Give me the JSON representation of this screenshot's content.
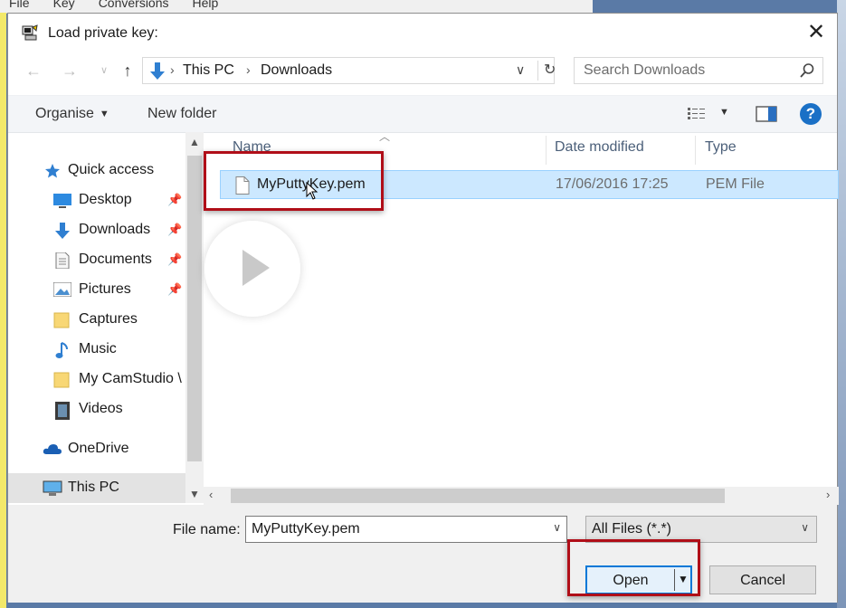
{
  "background": {
    "menu": [
      "File",
      "Key",
      "Conversions",
      "Help"
    ]
  },
  "dialog": {
    "title": "Load private key:",
    "close_glyph": "✕",
    "address": {
      "crumbs": [
        "This PC",
        "Downloads"
      ]
    },
    "search": {
      "placeholder": "Search Downloads"
    },
    "toolbar": {
      "organise": "Organise",
      "new_folder": "New folder",
      "help": "?"
    },
    "nav": {
      "items": [
        {
          "label": "Quick access",
          "icon": "star-icon"
        },
        {
          "label": "Desktop",
          "icon": "desktop-icon",
          "pinned": true
        },
        {
          "label": "Downloads",
          "icon": "download-arrow-icon",
          "pinned": true
        },
        {
          "label": "Documents",
          "icon": "document-icon",
          "pinned": true
        },
        {
          "label": "Pictures",
          "icon": "picture-icon",
          "pinned": true
        },
        {
          "label": "Captures",
          "icon": "folder-icon"
        },
        {
          "label": "Music",
          "icon": "music-note-icon"
        },
        {
          "label": "My CamStudio \\",
          "icon": "folder-icon"
        },
        {
          "label": "Videos",
          "icon": "film-icon"
        },
        {
          "label": "OneDrive",
          "icon": "cloud-icon"
        },
        {
          "label": "This PC",
          "icon": "computer-icon",
          "selected": true
        }
      ]
    },
    "columns": {
      "name": "Name",
      "date": "Date modified",
      "type": "Type"
    },
    "files": [
      {
        "name": "MyPuttyKey.pem",
        "date": "17/06/2016 17:25",
        "type": "PEM File"
      }
    ],
    "footer": {
      "file_name_label": "File name:",
      "file_name_value": "MyPuttyKey.pem",
      "filter_value": "All Files (*.*)",
      "open_label": "Open",
      "cancel_label": "Cancel"
    }
  },
  "colors": {
    "highlight_box": "#b00e18",
    "selection": "#cce8ff",
    "accent": "#0078d7"
  }
}
